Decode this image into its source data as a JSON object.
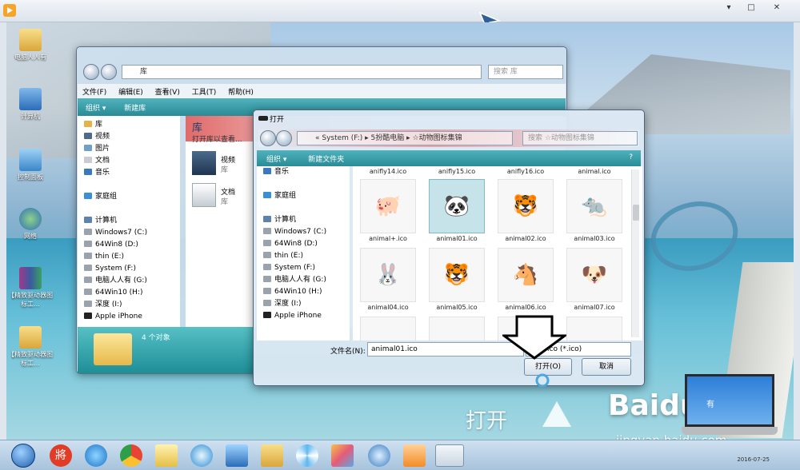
{
  "outer": {
    "close": "✕",
    "max": "□",
    "min": "▾"
  },
  "desktop": {
    "icons": [
      {
        "label": "电脑人人有"
      },
      {
        "label": "计算机"
      },
      {
        "label": "控制面板"
      },
      {
        "label": "网络"
      },
      {
        "label": "【精致驱动器图标工..."
      },
      {
        "label": "【精致驱动器图标工..."
      }
    ],
    "watermark": "打开",
    "baidu": "Baidu经验",
    "jingyan": "jingyan.baidu.com",
    "laptop_text": "有",
    "tray_date": "2016-07-25"
  },
  "library": {
    "address": "库",
    "search_placeholder": "搜索 库",
    "menu": [
      "文件(F)",
      "编辑(E)",
      "查看(V)",
      "工具(T)",
      "帮助(H)"
    ],
    "toolbar": [
      "组织 ▾",
      "新建库"
    ],
    "nav": [
      {
        "label": "库",
        "color": "#e6b24a"
      },
      {
        "label": "视频",
        "color": "#4f6b8a"
      },
      {
        "label": "图片",
        "color": "#6fa0c8"
      },
      {
        "label": "文档",
        "color": "#c9ccd0"
      },
      {
        "label": "音乐",
        "color": "#3a78c0"
      },
      {
        "label": "",
        "color": "transparent"
      },
      {
        "label": "家庭组",
        "color": "#3b8ed8"
      },
      {
        "label": "",
        "color": "transparent"
      },
      {
        "label": "计算机",
        "color": "#5b83ad"
      },
      {
        "label": "Windows7 (C:)",
        "color": "#9aa3ab"
      },
      {
        "label": "64Win8 (D:)",
        "color": "#9aa3ab"
      },
      {
        "label": "thin (E:)",
        "color": "#9aa3ab"
      },
      {
        "label": "System (F:)",
        "color": "#9aa3ab"
      },
      {
        "label": "电脑人人有 (G:)",
        "color": "#9aa3ab"
      },
      {
        "label": "64Win10 (H:)",
        "color": "#9aa3ab"
      },
      {
        "label": "深度 (I:)",
        "color": "#9aa3ab"
      },
      {
        "label": "Apple iPhone",
        "color": "#222"
      }
    ],
    "title": "库",
    "subtitle": "打开库以查看...",
    "items": [
      {
        "name": "视频",
        "sub": "库"
      },
      {
        "name": "文档",
        "sub": "库"
      }
    ],
    "status": "4 个对象"
  },
  "dialog": {
    "title": "打开",
    "breadcrumb": "« System (F:) ▸ 5扮酷电脑 ▸ ☆动物图标集锦",
    "search_placeholder": "搜索 ☆动物图标集锦",
    "toolbar": [
      "组织 ▾",
      "新建文件夹"
    ],
    "nav": [
      {
        "label": "音乐",
        "color": "#3a78c0"
      },
      {
        "label": "",
        "color": "transparent"
      },
      {
        "label": "家庭组",
        "color": "#3b8ed8"
      },
      {
        "label": "",
        "color": "transparent"
      },
      {
        "label": "计算机",
        "color": "#5b83ad"
      },
      {
        "label": "Windows7 (C:)",
        "color": "#9aa3ab"
      },
      {
        "label": "64Win8 (D:)",
        "color": "#9aa3ab"
      },
      {
        "label": "thin (E:)",
        "color": "#9aa3ab"
      },
      {
        "label": "System (F:)",
        "color": "#9aa3ab"
      },
      {
        "label": "电脑人人有 (G:)",
        "color": "#9aa3ab"
      },
      {
        "label": "64Win10 (H:)",
        "color": "#9aa3ab"
      },
      {
        "label": "深度 (I:)",
        "color": "#9aa3ab"
      },
      {
        "label": "Apple iPhone",
        "color": "#222"
      }
    ],
    "top_labels": [
      "anifly14.ico",
      "anifly15.ico",
      "anifly16.ico",
      "animal.ico"
    ],
    "files": [
      {
        "name": "animal+.ico",
        "icon": "🐖",
        "selected": false
      },
      {
        "name": "animal01.ico",
        "icon": "🐼",
        "selected": true
      },
      {
        "name": "animal02.ico",
        "icon": "🐯",
        "selected": false
      },
      {
        "name": "animal03.ico",
        "icon": "🐀",
        "selected": false
      },
      {
        "name": "animal04.ico",
        "icon": "🐰",
        "selected": false
      },
      {
        "name": "animal05.ico",
        "icon": "🐯",
        "selected": false
      },
      {
        "name": "animal06.ico",
        "icon": "🐴",
        "selected": false
      },
      {
        "name": "animal07.ico",
        "icon": "🐶",
        "selected": false
      }
    ],
    "filename_label": "文件名(N):",
    "filename_value": "animal01.ico",
    "filetype": "ico (*.ico)",
    "open_label": "打开(O)",
    "cancel_label": "取消"
  },
  "taskbar": {
    "items": [
      "start-orb",
      "jiang",
      "ie",
      "chrome",
      "folder-mail",
      "browser-360",
      "monitor",
      "explorer",
      "pinwheel",
      "paint",
      "media",
      "video",
      "drive"
    ]
  }
}
